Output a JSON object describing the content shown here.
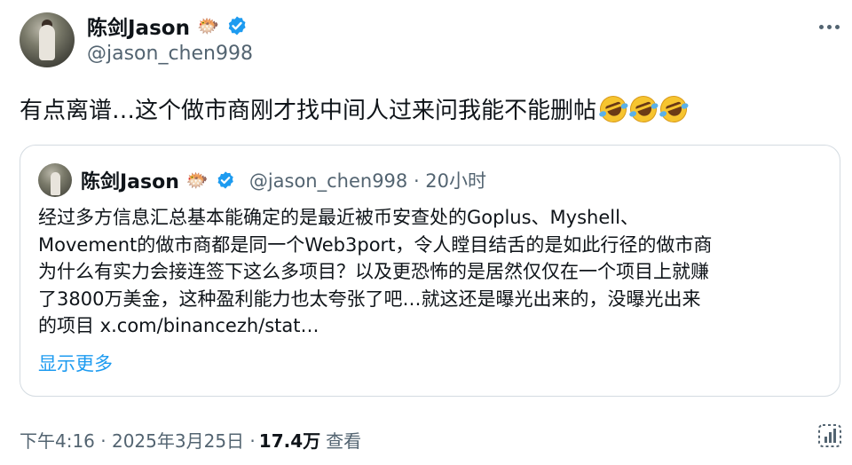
{
  "author": {
    "display_name": "陈剑Jason",
    "name_emoji": "🐡",
    "handle": "@jason_chen998"
  },
  "tweet": {
    "text": "有点离谱…这个做市商刚才找中间人过来问我能不能删帖",
    "emoji_count": 3
  },
  "quote": {
    "display_name": "陈剑Jason",
    "name_emoji": "🐡",
    "handle_time": "@jason_chen998 · 20小时",
    "lines": [
      "经过多方信息汇总基本能确定的是最近被币安查处的Goplus、Myshell、",
      "Movement的做市商都是同一个Web3port，令人瞠目结舌的是如此行径的做市商",
      "为什么有实力会接连签下这么多项目？以及更恐怖的是居然仅仅在一个项目上就赚",
      "了3800万美金，这种盈利能力也太夸张了吧…就这还是曝光出来的，没曝光出来",
      "的项目 x.com/binancezh/stat…"
    ],
    "show_more": "显示更多"
  },
  "meta": {
    "time_date": "下午4:16 · 2025年3月25日 ·",
    "views": "17.4万",
    "views_label": "查看"
  },
  "colors": {
    "verified": "#1d9bf0",
    "link": "#1d9bf0",
    "secondary_text": "#536471"
  },
  "icons": [
    "more-icon",
    "verified-badge-icon",
    "rolling-laughing-emoji",
    "analytics-icon"
  ]
}
